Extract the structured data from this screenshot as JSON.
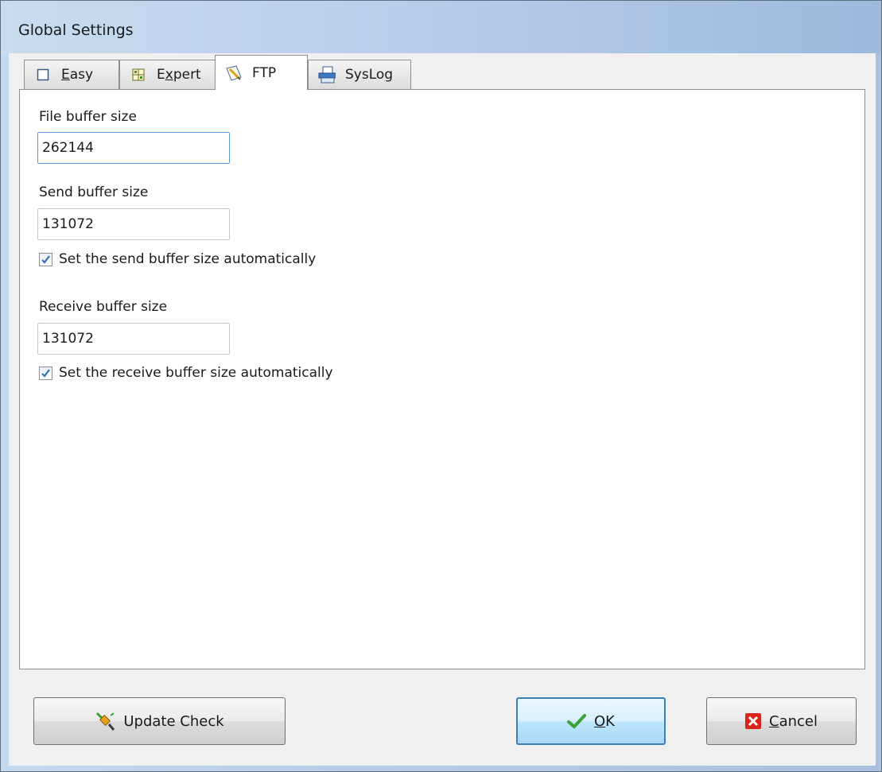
{
  "window": {
    "title": "Global Settings"
  },
  "tabs": [
    {
      "label_prefix": "",
      "label_ul": "E",
      "label_rest": "asy",
      "icon": "empty-square-icon",
      "active": false
    },
    {
      "label_prefix": "E",
      "label_ul": "x",
      "label_rest": "pert",
      "icon": "grid-icon",
      "active": false
    },
    {
      "label": "FTP",
      "icon": "pencil-paper-icon",
      "active": true
    },
    {
      "label": "SysLog",
      "icon": "document-tray-icon",
      "active": false
    }
  ],
  "ftp": {
    "file_buffer": {
      "label": "File buffer size",
      "value": "262144"
    },
    "send_buffer": {
      "label": "Send buffer size",
      "value": "131072",
      "auto_label": "Set the send buffer size automatically",
      "auto_checked": true
    },
    "receive_buffer": {
      "label": "Receive buffer size",
      "value": "131072",
      "auto_label": "Set the receive buffer size automatically",
      "auto_checked": true
    }
  },
  "buttons": {
    "update_check": "Update Check",
    "ok_ul": "O",
    "ok_rest": "K",
    "cancel_ul": "C",
    "cancel_rest": "ancel"
  },
  "colors": {
    "focus_border": "#5b9bd5",
    "checkmark": "#2f6db5",
    "ok_check": "#3aa335",
    "cancel_red": "#d9251c"
  }
}
